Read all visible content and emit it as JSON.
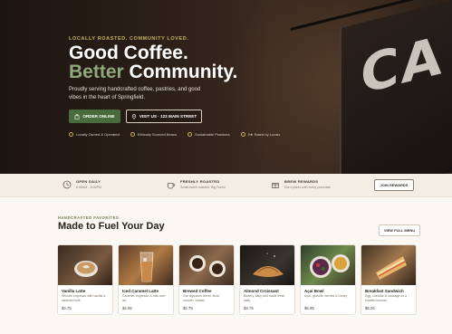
{
  "hero": {
    "eyebrow": "LOCALLY ROASTED. COMMUNITY LOVED.",
    "title_line1": "Good Coffee.",
    "title_accent": "Better",
    "title_line2_rest": " Community.",
    "lead": "Proudly serving handcrafted coffee, pastries, and good vibes in the heart of Springfield.",
    "order_button": "ORDER ONLINE",
    "visit_button": "VISIT US · 123 MAIN STREET",
    "sign_text": "CA",
    "features": [
      {
        "label": "Locally Owned & Operated",
        "icon": "home-icon"
      },
      {
        "label": "Ethically Sourced Beans",
        "icon": "leaf-icon"
      },
      {
        "label": "Sustainable Practices",
        "icon": "recycle-icon"
      },
      {
        "label": "5★ Rated by Locals",
        "icon": "star-icon"
      }
    ]
  },
  "strip": {
    "items": [
      {
        "title": "OPEN DAILY",
        "subtitle": "6:00AM - 8:00PM",
        "icon": "clock-icon"
      },
      {
        "title": "FRESHLY ROASTED",
        "subtitle": "Small-batch roasted, Big Flavor",
        "icon": "coffee-cup-icon"
      },
      {
        "title": "BREW REWARDS",
        "subtitle": "Earn points with every purchase",
        "icon": "gift-icon"
      }
    ],
    "rewards_button": "JOIN REWARDS"
  },
  "favorites": {
    "eyebrow": "HANDCRAFTED FAVORITES",
    "title": "Made to Fuel Your Day",
    "menu_button": "VIEW FULL MENU",
    "items": [
      {
        "name": "Vanilla Latte",
        "desc": "Smooth espresso with vanilla & steamed milk",
        "price": "$4.75"
      },
      {
        "name": "Iced Caramel Latte",
        "desc": "Caramel, espresso & milk over ice",
        "price": "$4.95"
      },
      {
        "name": "Brewed Coffee",
        "desc": "Our signature blend. Bold, smooth, classic.",
        "price": "$2.75"
      },
      {
        "name": "Almond Croissant",
        "desc": "Buttery, flaky and made fresh daily",
        "price": "$3.75"
      },
      {
        "name": "Açaí Bowl",
        "desc": "Açaí, granola, berries & honey",
        "price": "$6.95"
      },
      {
        "name": "Breakfast Sandwich",
        "desc": "Egg, cheddar & sausage on a toasted brioche",
        "price": "$6.25"
      }
    ]
  },
  "colors": {
    "accent_green": "#4a6b3d",
    "accent_gold": "#c8b25a",
    "hero_bg": "#2b1f18"
  }
}
